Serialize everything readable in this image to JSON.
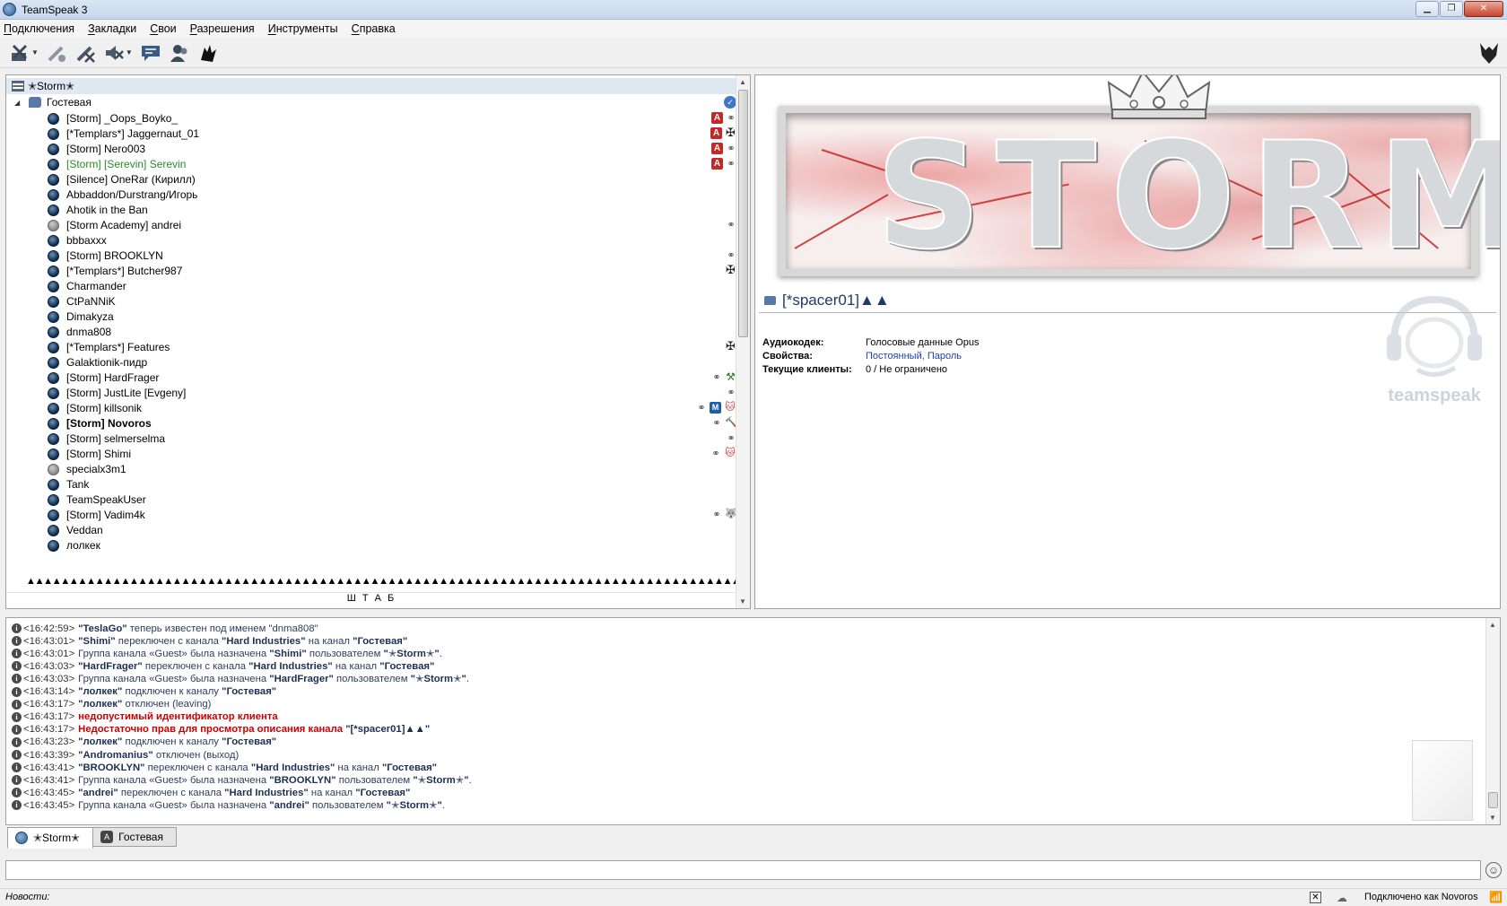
{
  "window": {
    "title": "TeamSpeak 3"
  },
  "menu": [
    "Подключения",
    "Закладки",
    "Свои",
    "Разрешения",
    "Инструменты",
    "Справка"
  ],
  "toolbar": {
    "icons": [
      "disconnect-icon",
      "away-icon",
      "mute-mic-icon",
      "mute-speakers-icon",
      "chat-icon",
      "contacts-icon",
      "wolf-icon"
    ],
    "right_icon": "wolf-head-icon"
  },
  "tree": {
    "server": "✭Storm✭",
    "channel": "Гостевая",
    "users": [
      {
        "name": "[Storm] _Oops_Boyko_",
        "badges": [
          "auth",
          "link"
        ]
      },
      {
        "name": "[*Templars*] Jaggernaut_01",
        "badges": [
          "auth",
          "cross"
        ]
      },
      {
        "name": "[Storm] Nero003",
        "badges": [
          "auth",
          "link"
        ]
      },
      {
        "name": "[Storm] [Serevin] Serevin",
        "badges": [
          "auth",
          "link"
        ],
        "style": "green"
      },
      {
        "name": "[Silence] OneRar (Кирилл)",
        "badges": []
      },
      {
        "name": "Abbaddon/Durstrang/Игорь",
        "badges": []
      },
      {
        "name": "Ahotik in the Ban",
        "badges": []
      },
      {
        "name": "[Storm Academy] andrei",
        "badges": [
          "link"
        ],
        "status": "away"
      },
      {
        "name": "bbbaxxx",
        "badges": []
      },
      {
        "name": "[Storm] BROOKLYN",
        "badges": [
          "link"
        ]
      },
      {
        "name": "[*Templars*] Butcher987",
        "badges": [
          "cross"
        ]
      },
      {
        "name": "Charmander",
        "badges": []
      },
      {
        "name": "CtPaNNiK",
        "badges": []
      },
      {
        "name": "Dimakyza",
        "badges": []
      },
      {
        "name": "dnma808",
        "badges": []
      },
      {
        "name": "[*Templars*] Features",
        "badges": [
          "cross"
        ]
      },
      {
        "name": "Galaktionik-пидр",
        "badges": []
      },
      {
        "name": "[Storm] HardFrager",
        "badges": [
          "link",
          "tool"
        ]
      },
      {
        "name": "[Storm] JustLite [Evgeny]",
        "badges": [
          "link"
        ]
      },
      {
        "name": "[Storm] killsonik",
        "badges": [
          "link",
          "m",
          "kitty"
        ]
      },
      {
        "name": "[Storm] Novoros",
        "badges": [
          "link",
          "hammer"
        ],
        "style": "bold"
      },
      {
        "name": "[Storm] selmerselma",
        "badges": [
          "link"
        ]
      },
      {
        "name": "[Storm] Shimi",
        "badges": [
          "link",
          "kitty"
        ]
      },
      {
        "name": "specialx3m1",
        "badges": [],
        "status": "away"
      },
      {
        "name": "Tank",
        "badges": []
      },
      {
        "name": "TeamSpeakUser",
        "badges": []
      },
      {
        "name": "[Storm] Vadim4k",
        "badges": [
          "link",
          "wolf"
        ]
      },
      {
        "name": "Veddan",
        "badges": []
      },
      {
        "name": "лолкек",
        "badges": []
      }
    ],
    "spacer": "▲▲▲▲▲▲▲▲▲▲▲▲▲▲▲▲▲▲▲▲▲▲▲▲▲▲▲▲▲▲▲▲▲▲▲▲▲▲▲▲▲▲▲▲▲▲▲▲▲▲▲▲▲▲▲▲▲▲▲▲▲▲▲▲▲▲▲▲▲▲▲▲▲▲▲▲▲▲▲▲▲▲▲▲▲▲▲",
    "hq_channel": "Ш Т А Б"
  },
  "info": {
    "banner_text": "STORM",
    "channel_title": "[*spacer01]▲▲",
    "rows": [
      {
        "label": "Аудиокодек:",
        "value": "Голосовые данные Opus",
        "link": false
      },
      {
        "label": "Свойства:",
        "value": "Постоянный, Пароль",
        "link": true
      },
      {
        "label": "Текущие клиенты:",
        "value": "0 / Не ограничено",
        "link": false
      }
    ],
    "watermark": "teamspeak"
  },
  "log": [
    [
      [
        "t",
        "<16:42:59>"
      ],
      [
        "b",
        "\"TeslaGo\""
      ],
      [
        "n",
        " теперь известен под именем "
      ],
      [
        "n",
        "\"dnma808\""
      ]
    ],
    [
      [
        "t",
        "<16:43:01>"
      ],
      [
        "b",
        "\"Shimi\""
      ],
      [
        "n",
        " переключен с канала "
      ],
      [
        "b",
        "\"Hard Industries\""
      ],
      [
        "n",
        " на канал "
      ],
      [
        "b",
        "\"Гостевая\""
      ]
    ],
    [
      [
        "t",
        "<16:43:01>"
      ],
      [
        "n",
        "Группа канала «Guest» была назначена "
      ],
      [
        "b",
        "\"Shimi\""
      ],
      [
        "n",
        " пользователем "
      ],
      [
        "b",
        "\"✭Storm✭\""
      ],
      [
        "n",
        "."
      ]
    ],
    [
      [
        "t",
        "<16:43:03>"
      ],
      [
        "b",
        "\"HardFrager\""
      ],
      [
        "n",
        " переключен с канала "
      ],
      [
        "b",
        "\"Hard Industries\""
      ],
      [
        "n",
        " на канал "
      ],
      [
        "b",
        "\"Гостевая\""
      ]
    ],
    [
      [
        "t",
        "<16:43:03>"
      ],
      [
        "n",
        "Группа канала «Guest» была назначена "
      ],
      [
        "b",
        "\"HardFrager\""
      ],
      [
        "n",
        " пользователем "
      ],
      [
        "b",
        "\"✭Storm✭\""
      ],
      [
        "n",
        "."
      ]
    ],
    [
      [
        "t",
        "<16:43:14>"
      ],
      [
        "b",
        "\"лолкек\""
      ],
      [
        "n",
        " подключен к каналу "
      ],
      [
        "b",
        "\"Гостевая\""
      ]
    ],
    [
      [
        "t",
        "<16:43:17>"
      ],
      [
        "b",
        "\"лолкек\""
      ],
      [
        "n",
        " отключен (leaving)"
      ]
    ],
    [
      [
        "t",
        "<16:43:17>"
      ],
      [
        "e",
        "недопустимый идентификатор клиента"
      ]
    ],
    [
      [
        "t",
        "<16:43:17>"
      ],
      [
        "e",
        "Недостаточно прав для просмотра описания канала "
      ],
      [
        "b",
        "\"[*spacer01]▲▲\""
      ]
    ],
    [
      [
        "t",
        "<16:43:23>"
      ],
      [
        "b",
        "\"лолкек\""
      ],
      [
        "n",
        " подключен к каналу "
      ],
      [
        "b",
        "\"Гостевая\""
      ]
    ],
    [
      [
        "t",
        "<16:43:39>"
      ],
      [
        "b",
        "\"Andromanius\""
      ],
      [
        "n",
        " отключен (выход)"
      ]
    ],
    [
      [
        "t",
        "<16:43:41>"
      ],
      [
        "b",
        "\"BROOKLYN\""
      ],
      [
        "n",
        " переключен с канала "
      ],
      [
        "b",
        "\"Hard Industries\""
      ],
      [
        "n",
        " на канал "
      ],
      [
        "b",
        "\"Гостевая\""
      ]
    ],
    [
      [
        "t",
        "<16:43:41>"
      ],
      [
        "n",
        "Группа канала «Guest» была назначена "
      ],
      [
        "b",
        "\"BROOKLYN\""
      ],
      [
        "n",
        " пользователем "
      ],
      [
        "b",
        "\"✭Storm✭\""
      ],
      [
        "n",
        "."
      ]
    ],
    [
      [
        "t",
        "<16:43:45>"
      ],
      [
        "b",
        "\"andrei\""
      ],
      [
        "n",
        " переключен с канала "
      ],
      [
        "b",
        "\"Hard Industries\""
      ],
      [
        "n",
        " на канал "
      ],
      [
        "b",
        "\"Гостевая\""
      ]
    ],
    [
      [
        "t",
        "<16:43:45>"
      ],
      [
        "n",
        "Группа канала «Guest» была назначена "
      ],
      [
        "b",
        "\"andrei\""
      ],
      [
        "n",
        " пользователем "
      ],
      [
        "b",
        "\"✭Storm✭\""
      ],
      [
        "n",
        "."
      ]
    ]
  ],
  "tabs": [
    {
      "label": "✭Storm✭",
      "icon": "server",
      "active": true
    },
    {
      "label": "Гостевая",
      "icon": "channel",
      "active": false
    }
  ],
  "chat": {
    "placeholder": ""
  },
  "status": {
    "news": "Новости:",
    "connection": "Подключено как Novoros"
  },
  "colors": {
    "accent": "#1d3a6b",
    "error": "#cc0000",
    "green_user": "#2a8a2a"
  }
}
